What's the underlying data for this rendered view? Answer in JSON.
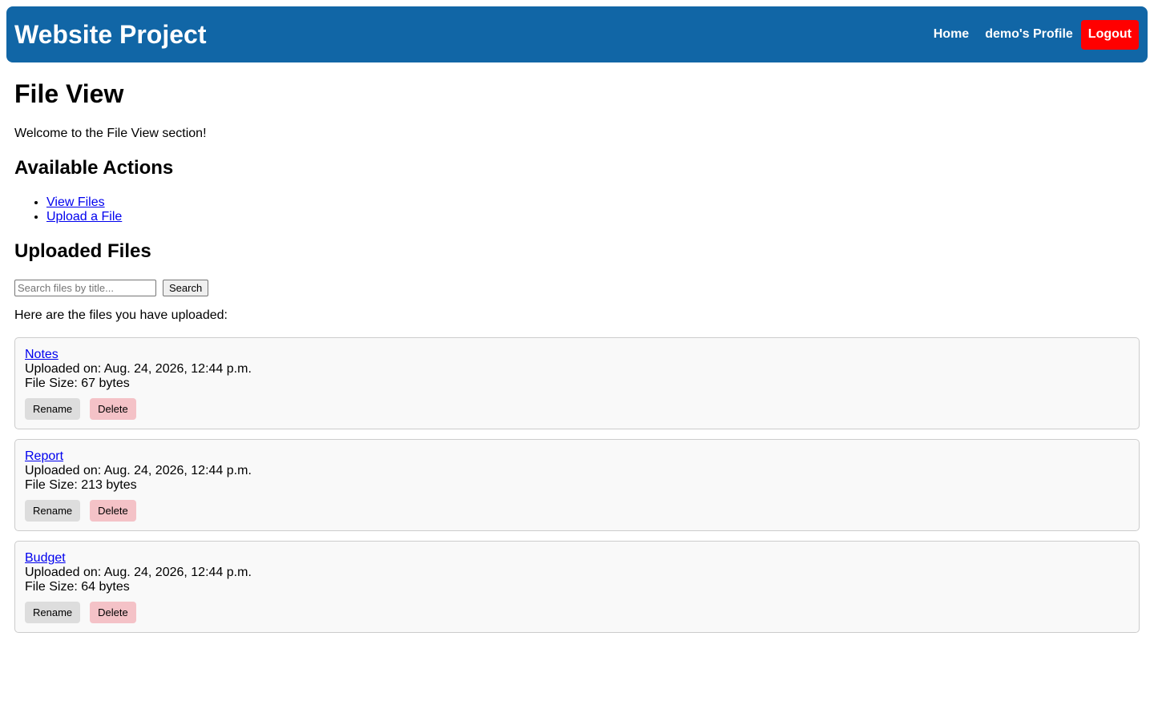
{
  "navbar": {
    "brand": "Website Project",
    "home_label": "Home",
    "profile_label": "demo's Profile",
    "logout_label": "Logout"
  },
  "page": {
    "title": "File View",
    "welcome": "Welcome to the File View section!"
  },
  "actions": {
    "heading": "Available Actions",
    "items": [
      {
        "label": "View Files"
      },
      {
        "label": "Upload a File"
      }
    ]
  },
  "files": {
    "heading": "Uploaded Files",
    "search_placeholder": "Search files by title...",
    "search_button": "Search",
    "intro": "Here are the files you have uploaded:",
    "rename_label": "Rename",
    "delete_label": "Delete",
    "list": [
      {
        "title": "Notes",
        "uploaded": "Uploaded on: Aug. 24, 2026, 12:44 p.m.",
        "size": "File Size: 67 bytes"
      },
      {
        "title": "Report",
        "uploaded": "Uploaded on: Aug. 24, 2026, 12:44 p.m.",
        "size": "File Size: 213 bytes"
      },
      {
        "title": "Budget",
        "uploaded": "Uploaded on: Aug. 24, 2026, 12:44 p.m.",
        "size": "File Size: 64 bytes"
      }
    ]
  },
  "colors": {
    "navbar": "#1166a6",
    "logout": "#ff0000",
    "delete": "#f4c2c7",
    "rename": "#dddddd",
    "link": "#0000ee"
  }
}
